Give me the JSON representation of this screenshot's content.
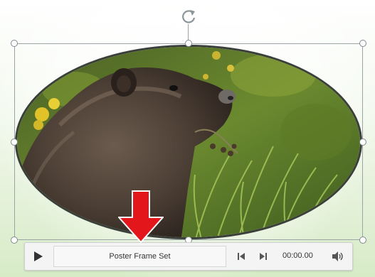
{
  "controls": {
    "timeline_label": "Poster Frame Set",
    "time": "00:00.00"
  },
  "icons": {
    "rotate": "rotate-handle-icon",
    "play": "play-icon",
    "prev": "step-back-icon",
    "next": "step-forward-icon",
    "volume": "volume-icon",
    "arrow": "red-down-arrow-icon"
  },
  "colors": {
    "arrow_red": "#e3161b",
    "frame_gray": "#9aa3a8"
  }
}
